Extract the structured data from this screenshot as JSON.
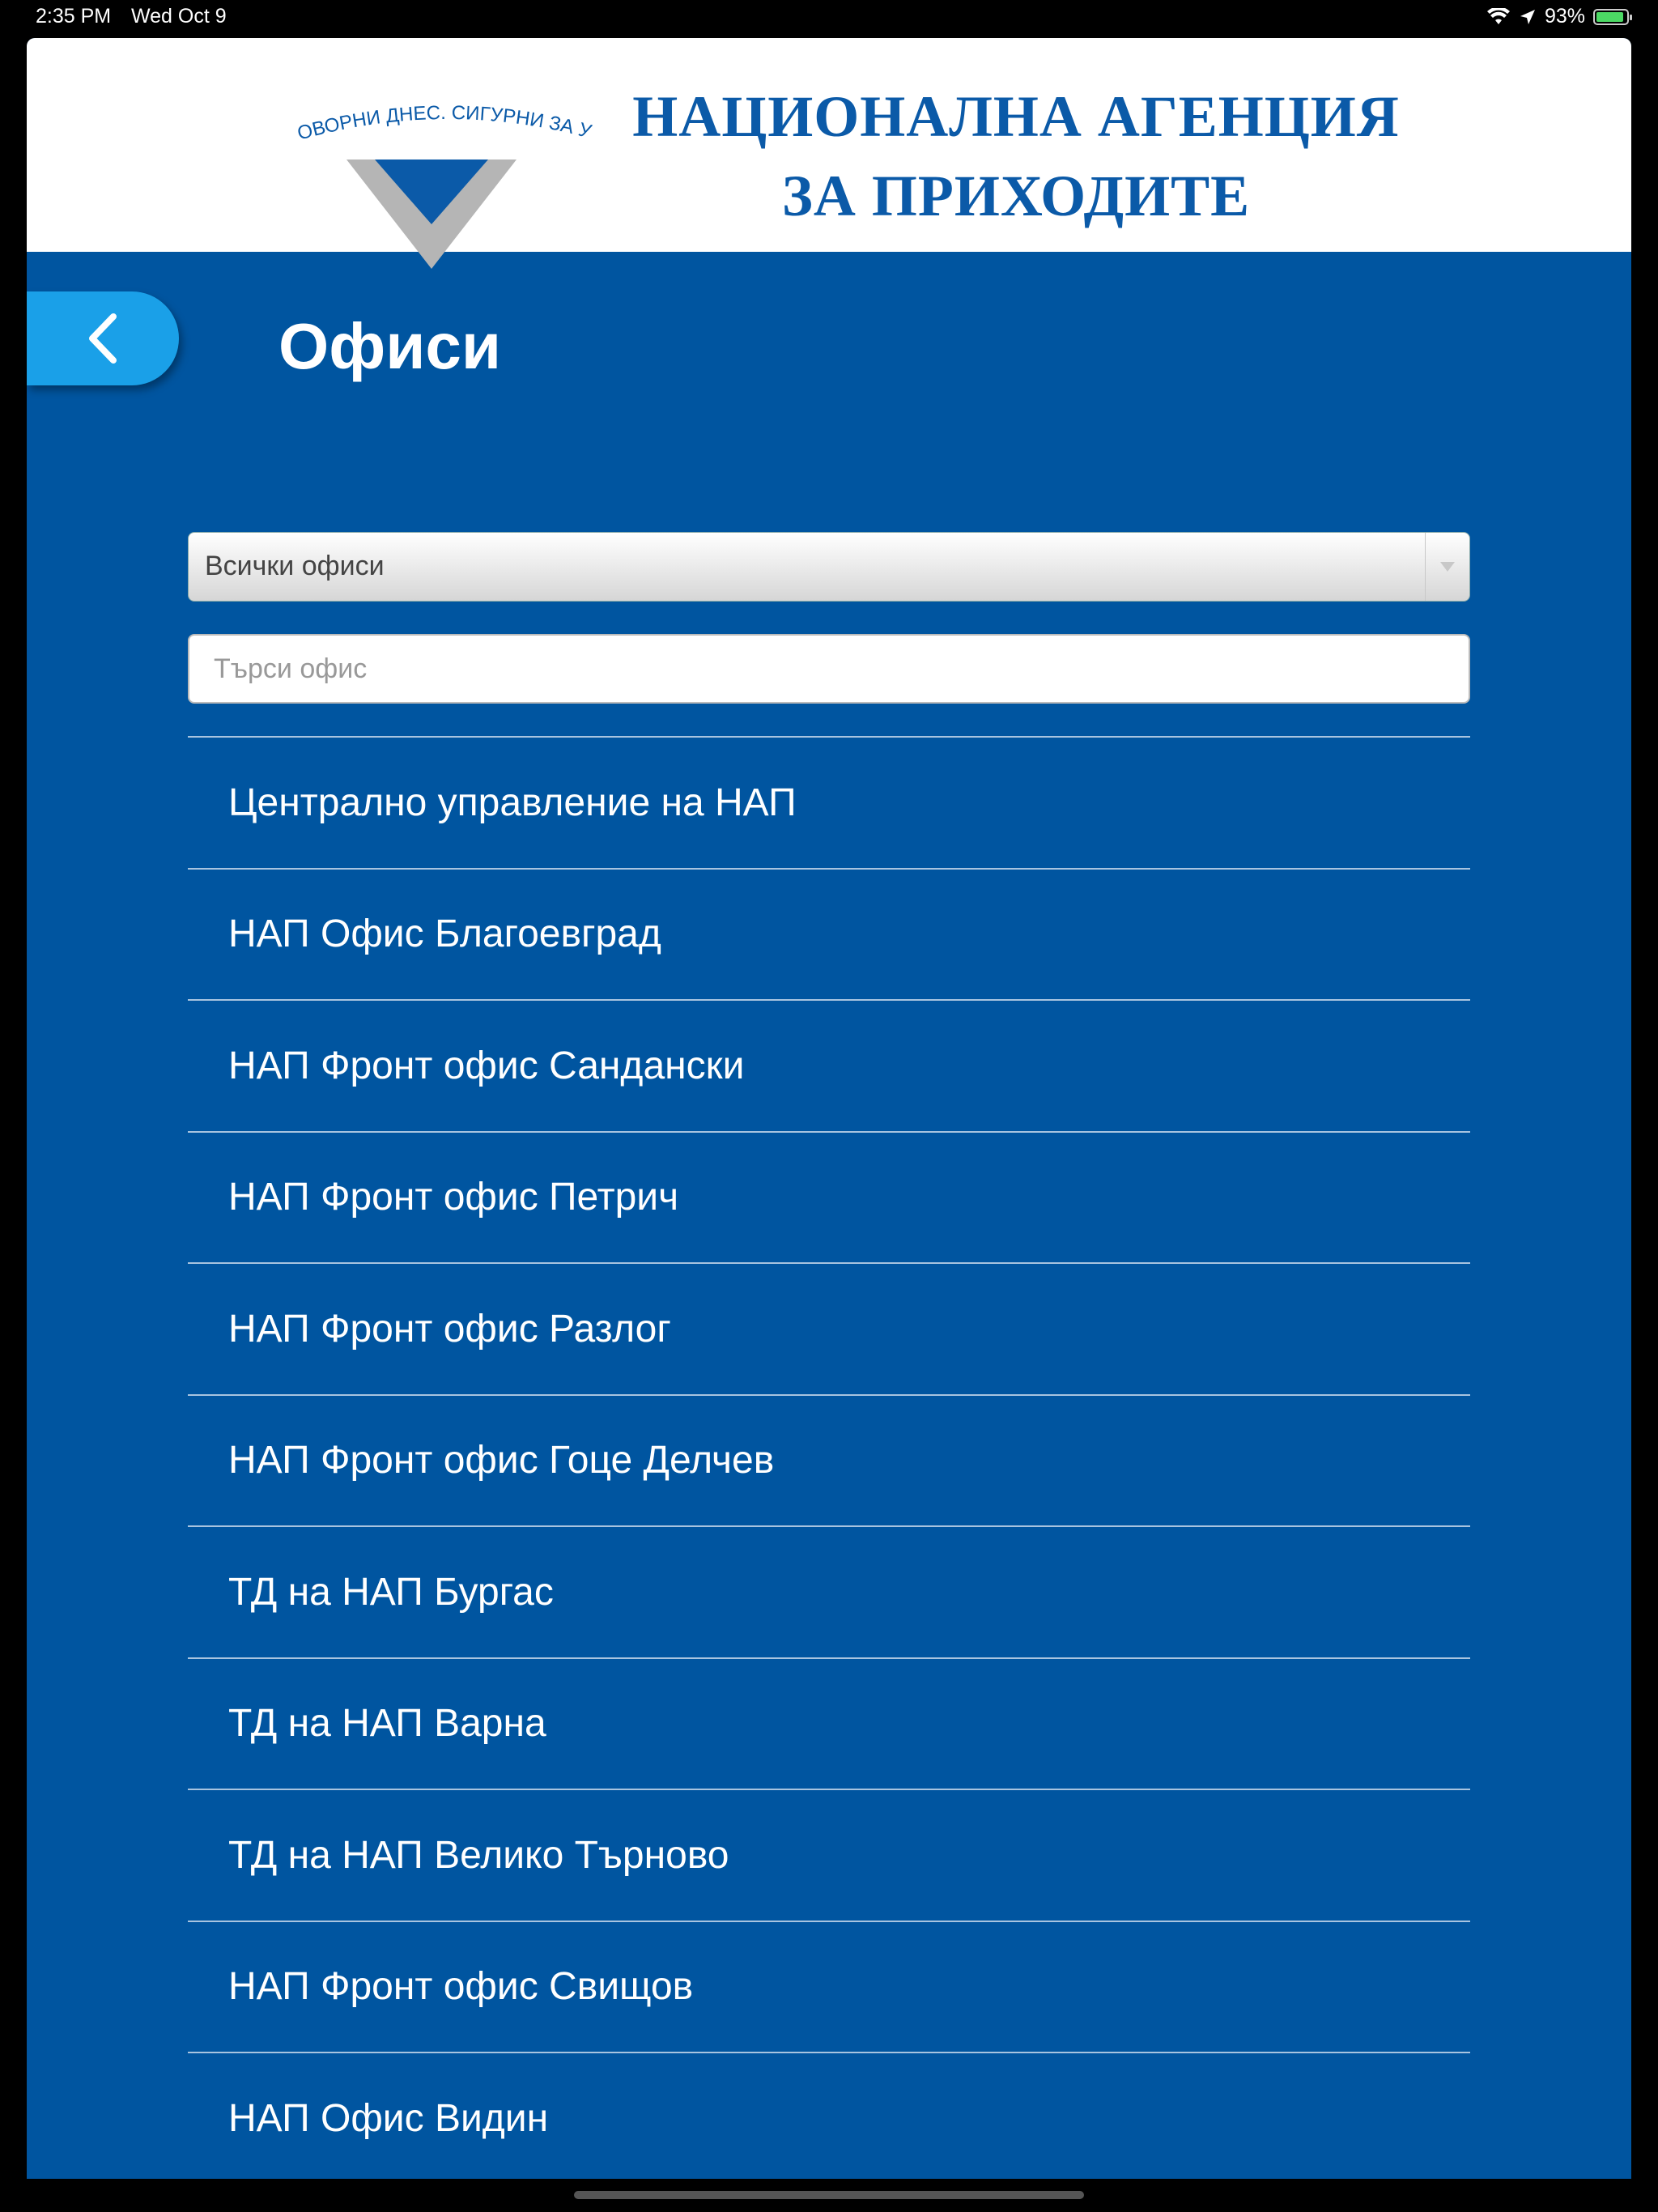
{
  "status_bar": {
    "time": "2:35 PM",
    "date": "Wed Oct 9",
    "battery": "93%",
    "battery_level": 0.93
  },
  "header": {
    "logo_slogan": "ОТГОВОРНИ ДНЕС. СИГУРНИ ЗА УТРЕ.",
    "agency_name_line1": "НАЦИОНАЛНА АГЕНЦИЯ",
    "agency_name_line2": "ЗА ПРИХОДИТЕ",
    "brand_color": "#0b5aa8"
  },
  "nav": {
    "back_icon": "chevron-left-icon",
    "title": "Офиси"
  },
  "filter": {
    "selected": "Всички офиси",
    "arrow_icon": "triangle-down-icon"
  },
  "search": {
    "placeholder": "Търси офис",
    "value": ""
  },
  "offices": [
    "Централно управление на НАП",
    "НАП Офис Благоевград",
    "НАП Фронт офис Сандански",
    "НАП Фронт офис Петрич",
    "НАП Фронт офис Разлог",
    "НАП Фронт офис Гоце Делчев",
    "ТД на НАП Бургас",
    "ТД на НАП Варна",
    "ТД на НАП Велико Търново",
    "НАП Фронт офис Свищов",
    "НАП Офис Видин"
  ],
  "colors": {
    "background": "#0055a0",
    "back_button": "#1aa0e8"
  }
}
